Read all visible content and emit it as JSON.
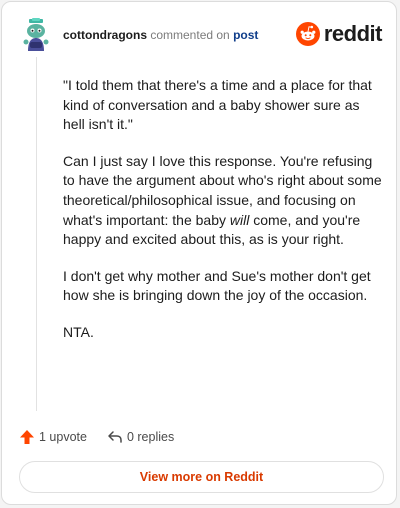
{
  "header": {
    "username": "cottondragons",
    "action_text": "commented on",
    "post_link": "post",
    "brand_word": "reddit"
  },
  "comment": {
    "paragraph_1": "\"I told them that there's a time and a place for that kind of conversation and a baby shower sure as hell isn't it.\"",
    "paragraph_2_a": "Can I just say I love this response. You're refusing to have the argument about who's right about some theoretical/philosophical issue, and focusing on what's important: the baby ",
    "paragraph_2_em": "will",
    "paragraph_2_b": " come, and you're happy and excited about this, as is your right.",
    "paragraph_3": "I don't get why mother and Sue's mother don't get how she is bringing down the joy of the occasion.",
    "paragraph_4": "NTA."
  },
  "actions": {
    "upvote_label": "1 upvote",
    "replies_label": "0 replies"
  },
  "footer": {
    "view_more_label": "View more on Reddit"
  },
  "colors": {
    "reddit_orange": "#ff4500",
    "upvote_arrow": "#ff4500",
    "link_blue": "#0f3d8a",
    "view_more_text": "#d93a00"
  }
}
